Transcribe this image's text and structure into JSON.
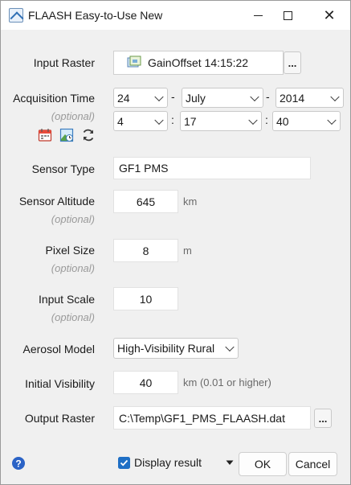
{
  "window": {
    "title": "FLAASH Easy-to-Use New"
  },
  "input_raster": {
    "label": "Input Raster",
    "value": "GainOffset 14:15:22",
    "browse": "..."
  },
  "acquisition": {
    "label": "Acquisition Time",
    "optional": "(optional)",
    "day": "24",
    "month": "July",
    "year": "2014",
    "hour": "4",
    "minute": "17",
    "second": "40",
    "date_sep": "-",
    "time_sep": ":"
  },
  "sensor_type": {
    "label": "Sensor Type",
    "value": "GF1 PMS"
  },
  "sensor_altitude": {
    "label": "Sensor Altitude",
    "optional": "(optional)",
    "value": "645",
    "unit": "km"
  },
  "pixel_size": {
    "label": "Pixel Size",
    "optional": "(optional)",
    "value": "8",
    "unit": "m"
  },
  "input_scale": {
    "label": "Input Scale",
    "optional": "(optional)",
    "value": "10"
  },
  "aerosol_model": {
    "label": "Aerosol Model",
    "value": "High-Visibility Rural"
  },
  "initial_visibility": {
    "label": "Initial Visibility",
    "value": "40",
    "unit": "km  (0.01 or higher)"
  },
  "output_raster": {
    "label": "Output Raster",
    "value": "C:\\Temp\\GF1_PMS_FLAASH.dat",
    "browse": "..."
  },
  "footer": {
    "display_result": "Display result",
    "display_checked": true,
    "ok": "OK",
    "cancel": "Cancel"
  },
  "colors": {
    "accent": "#1f6fc5",
    "optional_text": "#9a9a9a",
    "unit_text": "#6a6a6a"
  },
  "icons": [
    "app-icon",
    "minimize-icon",
    "maximize-icon",
    "close-icon",
    "raster-icon",
    "calendar-icon",
    "image-time-icon",
    "refresh-icon",
    "help-icon",
    "checkbox-icon",
    "dropdown-arrow-icon"
  ]
}
